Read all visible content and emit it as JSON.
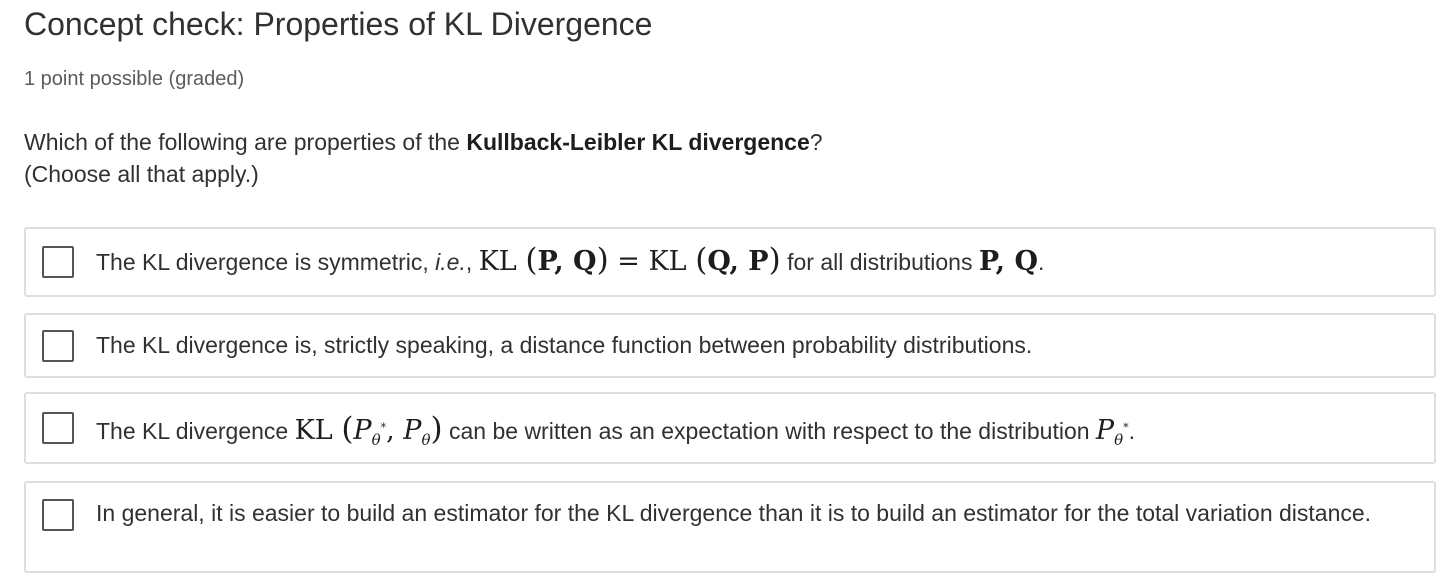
{
  "problem": {
    "title": "Concept check: Properties of KL Divergence",
    "points": "1 point possible (graded)",
    "prompt_pre": "Which of the following are properties of the ",
    "prompt_bold": "Kullback-Leibler KL divergence",
    "prompt_post": "?",
    "prompt_line2": "(Choose all that apply.)"
  },
  "choices": [
    {
      "text_pre": "The KL divergence is symmetric, ",
      "text_ie": "i.e.",
      "text_mid": ", ",
      "math_lhs_fn": "KL",
      "math_lhs_args": "P, Q",
      "math_eq": " = ",
      "math_rhs_fn": "KL",
      "math_rhs_args": "Q, P",
      "text_post": " for all distributions ",
      "math_tail": "P, Q",
      "text_end": ".",
      "checked": false
    },
    {
      "text": "The KL divergence is, strictly speaking, a distance function between probability distributions.",
      "checked": false
    },
    {
      "text_pre": "The KL divergence ",
      "math_fn": "KL",
      "math_p": "P",
      "math_sub": "θ",
      "math_sup": "*",
      "math_comma": ", ",
      "math_p2": "P",
      "math_sub2": "θ",
      "text_post": " can be written as an expectation with respect to the distribution ",
      "math_p3": "P",
      "math_sub3": "θ",
      "math_sup3": "*",
      "text_end": ".",
      "checked": false
    },
    {
      "text": "In general, it is easier to build an estimator for the KL divergence than it is to build an estimator for the total variation distance.",
      "checked": false
    }
  ]
}
